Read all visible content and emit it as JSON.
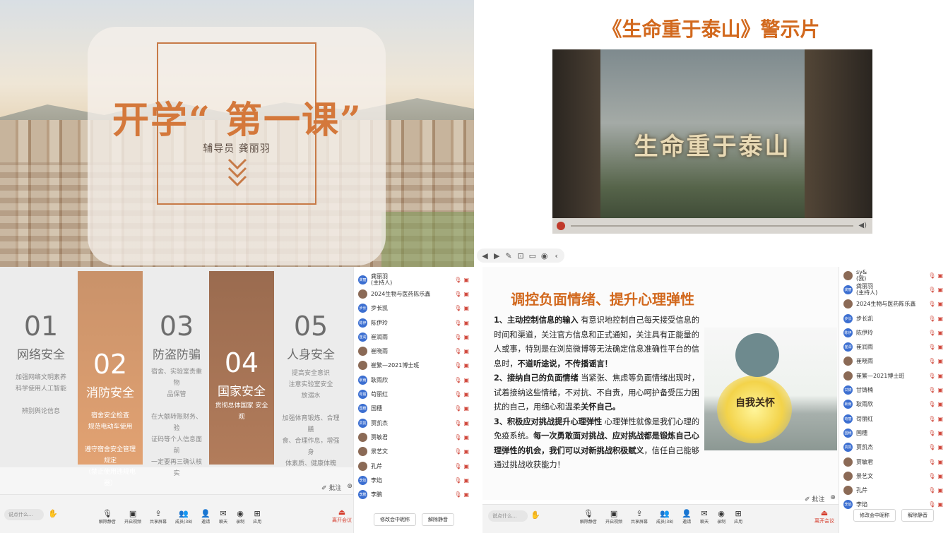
{
  "q1": {
    "title": "开学“ 第一课”",
    "subtitle": "辅导员    龚丽羽"
  },
  "q2": {
    "title": "《生命重于泰山》警示片",
    "video_text": "生命重于泰山",
    "toolbar": [
      "◀",
      "▶",
      "✎",
      "⊡",
      "▭",
      "◉",
      "‹"
    ]
  },
  "q3": {
    "cells": [
      {
        "num": "01",
        "name": "网络安全",
        "desc": "加强网络文明素养\n科学使用人工智能\n\n辨别舆论信息"
      },
      {
        "num": "02",
        "name": "消防安全",
        "desc": "宿舍安全检查\n规范电动车使用\n\n遵守宿舍安全管理规定\n（禁止使用违规电器）"
      },
      {
        "num": "03",
        "name": "防盗防骗",
        "desc": "宿舍、实验室贵重物\n品保管\n\n在大额转账财务、验\n证码等个人信息面前\n一定要再三确认核实"
      },
      {
        "num": "04",
        "name": "国家安全",
        "desc": "贯彻总体国家\n安全观"
      },
      {
        "num": "05",
        "name": "人身安全",
        "desc": "提高安全意识\n注意实验室安全\n放溺水\n\n加强体育锻炼、合理膳\n食、合理作息，增强身\n体素质、健康体魄"
      }
    ],
    "annotate": "✐ 批注",
    "zoom": "⊕",
    "chat_placeholder": "说点什么...",
    "tools": [
      "解除静音",
      "开启视频",
      "共享屏幕",
      "成员(38)",
      "邀请",
      "聊天",
      "录制",
      "应用"
    ],
    "leave": "离开会议",
    "participants": [
      {
        "av": "龚丽",
        "name": "龚丽羽\n(主持人)"
      },
      {
        "av": "",
        "name": "2024生物与医药陈乐鑫"
      },
      {
        "av": "步长",
        "name": "步长凯"
      },
      {
        "av": "陈伊",
        "name": "陈伊玲"
      },
      {
        "av": "崔润",
        "name": "崔润雨"
      },
      {
        "av": "",
        "name": "崔晓雨"
      },
      {
        "av": "",
        "name": "崔繁—2021博士班"
      },
      {
        "av": "耿雨",
        "name": "耿雨欣"
      },
      {
        "av": "苟丽",
        "name": "苟丽红"
      },
      {
        "av": "国穗",
        "name": "国穗"
      },
      {
        "av": "贾凯",
        "name": "贾凯杰"
      },
      {
        "av": "",
        "name": "贾敏君"
      },
      {
        "av": "",
        "name": "景艺文"
      },
      {
        "av": "",
        "name": "孔芹"
      },
      {
        "av": "李焰",
        "name": "李焰"
      },
      {
        "av": "李鹏",
        "name": "李鹏"
      }
    ],
    "btn_rename": "修改会中昵称",
    "btn_unmute": "解除静音"
  },
  "q4": {
    "title": "调控负面情绪、提升心理弹性",
    "p1_head": "1、主动控制信息的输入",
    "p1_body": "有意识地控制自己每天接受信息的时间和渠道，关注官方信息和正式通知，关注具有正能量的人或事，特别是在浏览微博等无法确定信息准确性平台的信息时，",
    "p1_tail": "不道听途说，不传播谣言！",
    "p2_head": "2、接纳自己的负面情绪",
    "p2_body": "当紧张、焦虑等负面情绪出现时，试着接纳这些情绪，不对抗、不自责，用心呵护备受压力困扰的自己，用细心和温柔",
    "p2_tail": "关怀自己。",
    "p3_head": "3、积极应对挑战提升心理弹性",
    "p3_body": "心理弹性就像是我们心理的免疫系统。",
    "p3_bold": "每一次勇敢面对挑战、应对挑战都是锻炼自己心理弹性的机会，我们可以对新挑战",
    "p3_b2": "积极赋义",
    "p3_end": "，信任自己能够通过挑战收获能力！",
    "illus_text": "自我关怀",
    "annotate": "✐ 批注",
    "zoom": "⊕",
    "chat_placeholder": "说点什么...",
    "tools": [
      "解除静音",
      "开启视频",
      "共享屏幕",
      "成员(38)",
      "邀请",
      "聊天",
      "录制",
      "应用"
    ],
    "leave": "离开会议",
    "participants": [
      {
        "av": "",
        "name": "sy&\n(我)"
      },
      {
        "av": "龚丽",
        "name": "龚丽羽\n(主持人)"
      },
      {
        "av": "",
        "name": "2024生物与医药陈乐鑫"
      },
      {
        "av": "步长",
        "name": "步长凯"
      },
      {
        "av": "陈伊",
        "name": "陈伊玲"
      },
      {
        "av": "崔润",
        "name": "崔润雨"
      },
      {
        "av": "",
        "name": "崔晓雨"
      },
      {
        "av": "",
        "name": "崔繁—2021博士班"
      },
      {
        "av": "甘铸",
        "name": "甘铸楠"
      },
      {
        "av": "耿雨",
        "name": "耿雨欣"
      },
      {
        "av": "苟丽",
        "name": "苟丽红"
      },
      {
        "av": "国穗",
        "name": "国穗"
      },
      {
        "av": "贾凯",
        "name": "贾凯杰"
      },
      {
        "av": "",
        "name": "贾敏君"
      },
      {
        "av": "",
        "name": "景艺文"
      },
      {
        "av": "",
        "name": "孔芹"
      },
      {
        "av": "李焰",
        "name": "李焰"
      }
    ],
    "btn_rename": "修改会中昵称",
    "btn_unmute": "解除静音"
  }
}
